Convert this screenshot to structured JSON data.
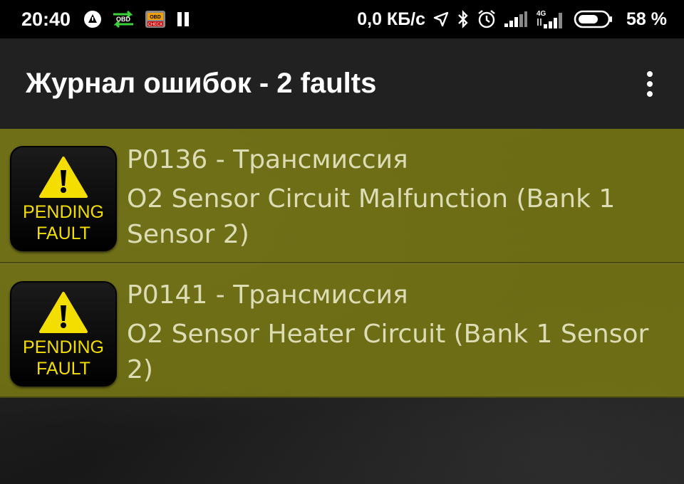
{
  "status_bar": {
    "time": "20:40",
    "obd_label": "OBD",
    "check_label": "CHECK",
    "network_speed": "0,0 КБ/с",
    "network_type": "4G",
    "battery_percent": "58 %",
    "icons": [
      "alert-triangle-icon",
      "obd-transfer-icon",
      "obd-check-icon",
      "pause-icon",
      "location-icon",
      "bluetooth-icon",
      "alarm-icon",
      "signal-icon",
      "signal-4g-icon",
      "battery-icon"
    ]
  },
  "app_bar": {
    "title": "Журнал ошибок - 2 faults",
    "menu_icon": "more-vert-icon"
  },
  "faults": [
    {
      "code": "P0136 - Трансмиссия",
      "description": "O2 Sensor Circuit Malfunction (Bank 1 Sensor 2)",
      "badge_line1": "PENDING",
      "badge_line2": "FAULT"
    },
    {
      "code": "P0141 - Трансмиссия",
      "description": "O2 Sensor Heater Circuit (Bank 1 Sensor 2)",
      "badge_line1": "PENDING",
      "badge_line2": "FAULT"
    }
  ],
  "colors": {
    "row_background": "#7a7a14",
    "text": "#ddddb5",
    "badge_text": "#f4de00",
    "app_bar": "#212121"
  }
}
